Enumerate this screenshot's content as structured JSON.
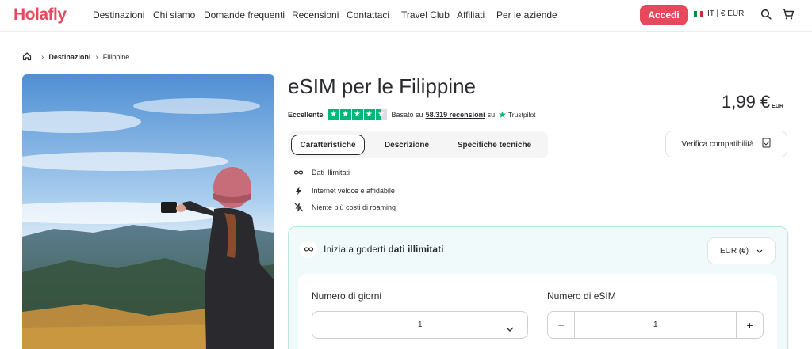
{
  "header": {
    "logo": "Holafly",
    "nav": [
      "Destinazioni",
      "Chi siamo",
      "Domande frequenti",
      "Recensioni",
      "Contattaci",
      "Travel Club",
      "Affiliati",
      "Per le aziende"
    ],
    "login_label": "Accedi",
    "locale": "IT | € EUR",
    "icons": [
      "search-icon",
      "cart-icon"
    ],
    "accent_color": "#e6485c"
  },
  "breadcrumb": {
    "home_icon": "home-icon",
    "items": [
      "Destinazioni",
      "Filippine"
    ]
  },
  "product": {
    "title": "eSIM per le Filippine",
    "rating_label": "Eccellente",
    "stars": 4.5,
    "reviews_prefix": "Basato su",
    "reviews_count": "58.319 recensioni",
    "reviews_suffix": "su",
    "trustpilot": "Trustpilot",
    "price": "1,99 €",
    "price_currency": "EUR"
  },
  "tabs": [
    "Caratteristiche",
    "Descrizione",
    "Specifiche tecniche"
  ],
  "verify_label": "Verifica compatibilità",
  "features": [
    {
      "icon": "infinity-icon",
      "label": "Dati illimitati"
    },
    {
      "icon": "lightning-icon",
      "label": "Internet veloce e affidabile"
    },
    {
      "icon": "no-roaming-icon",
      "label": "Niente più costi di roaming"
    }
  ],
  "plan": {
    "heading_prefix": "Inizia a goderti",
    "heading_bold": "dati illimitati",
    "currency_select": "EUR (€)",
    "days_label": "Numero di giorni",
    "days_value": "1",
    "esim_label": "Numero di eSIM",
    "esim_value": "1",
    "minus": "−",
    "plus": "+"
  }
}
